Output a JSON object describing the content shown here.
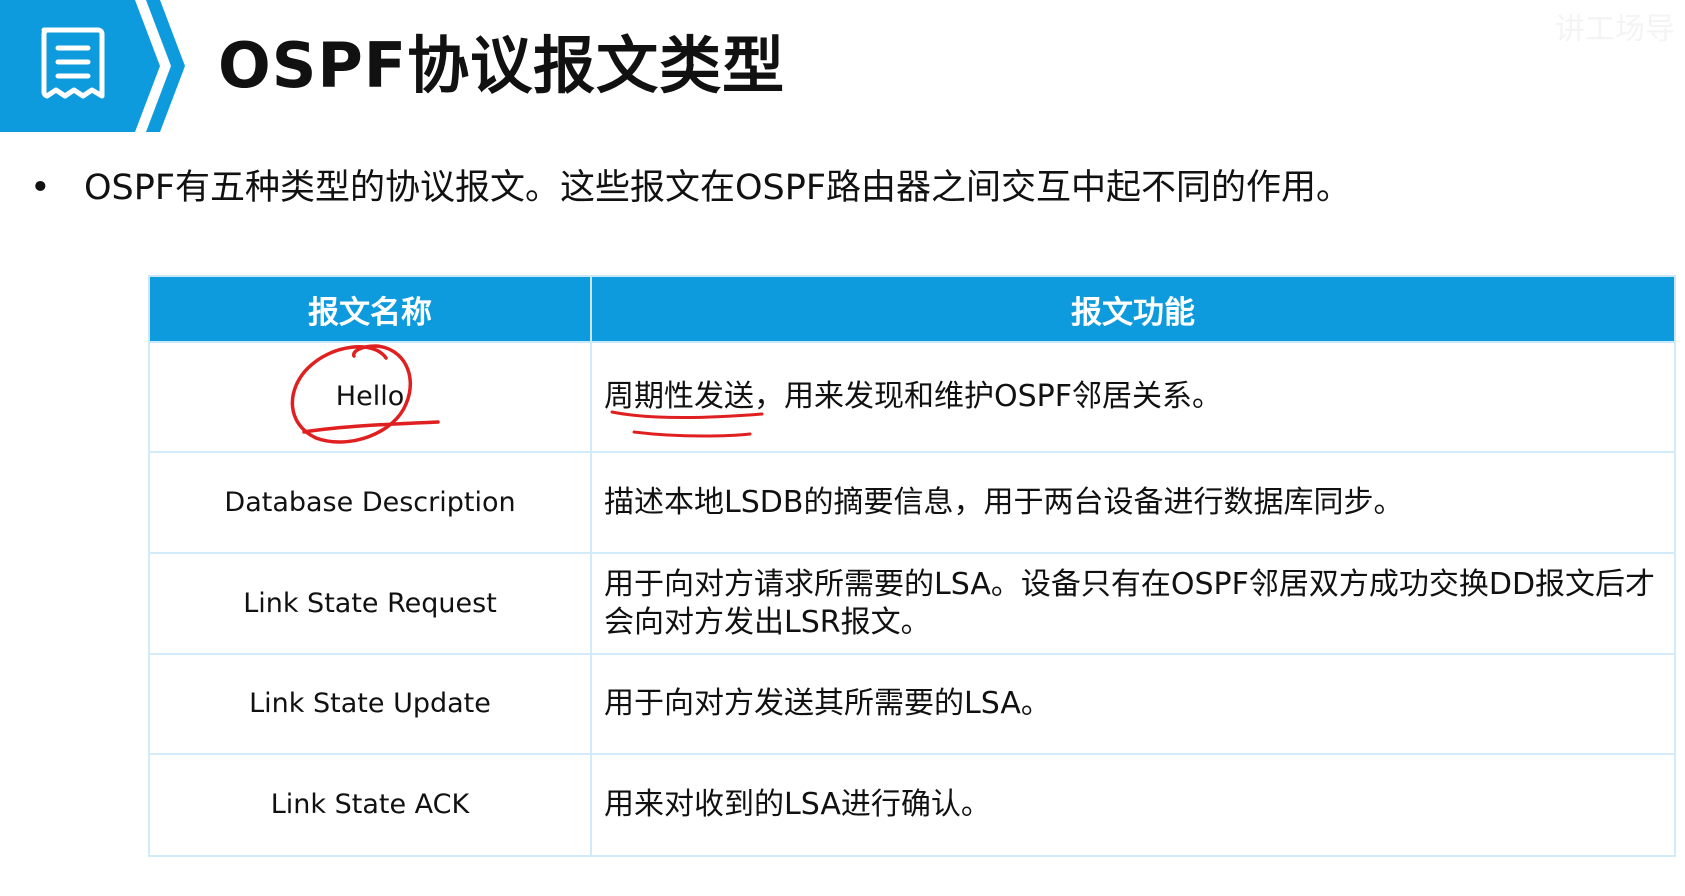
{
  "slide": {
    "title": "OSPF协议报文类型",
    "watermark": "讲工场导",
    "intro_bullet": "•",
    "intro": "OSPF有五种类型的协议报文。这些报文在OSPF路由器之间交互中起不同的作用。"
  },
  "table": {
    "headers": [
      "报文名称",
      "报文功能"
    ],
    "rows": [
      {
        "name": "Hello",
        "func_marked": "周期性发送",
        "func_rest": "，用来发现和维护OSPF邻居关系。"
      },
      {
        "name": "Database Description",
        "func": "描述本地LSDB的摘要信息，用于两台设备进行数据库同步。"
      },
      {
        "name": "Link State Request",
        "func": "用于向对方请求所需要的LSA。设备只有在OSPF邻居双方成功交换DD报文后才会向对方发出LSR报文。"
      },
      {
        "name": "Link State Update",
        "func": "用于向对方发送其所需要的LSA。"
      },
      {
        "name": "Link State ACK",
        "func": "用来对收到的LSA进行确认。"
      }
    ]
  },
  "colors": {
    "header_blue": "#0e9bde",
    "annotation_red": "#e02020"
  },
  "icons": {
    "header_icon": "document-list-icon"
  }
}
